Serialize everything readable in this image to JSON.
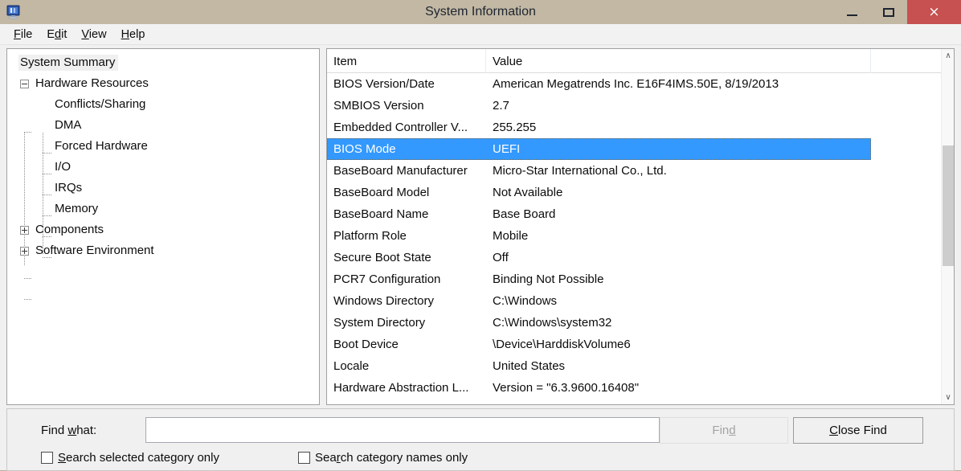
{
  "window": {
    "title": "System Information",
    "icon": "system-information-icon",
    "titlebar_color": "#c2b8a3",
    "close_button_color": "#c75050",
    "caption": {
      "minimize": "minimize-icon",
      "maximize": "maximize-icon",
      "close": "×"
    }
  },
  "menubar": [
    {
      "label": "File",
      "accel_before": "",
      "accel": "F",
      "accel_after": "ile"
    },
    {
      "label": "Edit",
      "accel_before": "E",
      "accel": "d",
      "accel_after": "it"
    },
    {
      "label": "View",
      "accel_before": "",
      "accel": "V",
      "accel_after": "iew"
    },
    {
      "label": "Help",
      "accel_before": "",
      "accel": "H",
      "accel_after": "elp"
    }
  ],
  "tree": {
    "selected": "System Summary",
    "selection_color": "#f0f0f0",
    "nodes": [
      {
        "label": "System Summary",
        "level": 0,
        "expander": "none",
        "selected": true
      },
      {
        "label": "Hardware Resources",
        "level": 0,
        "expander": "minus",
        "selected": false
      },
      {
        "label": "Conflicts/Sharing",
        "level": 1,
        "expander": "none",
        "selected": false
      },
      {
        "label": "DMA",
        "level": 1,
        "expander": "none",
        "selected": false
      },
      {
        "label": "Forced Hardware",
        "level": 1,
        "expander": "none",
        "selected": false
      },
      {
        "label": "I/O",
        "level": 1,
        "expander": "none",
        "selected": false
      },
      {
        "label": "IRQs",
        "level": 1,
        "expander": "none",
        "selected": false
      },
      {
        "label": "Memory",
        "level": 1,
        "expander": "none",
        "selected": false
      },
      {
        "label": "Components",
        "level": 0,
        "expander": "plus",
        "selected": false
      },
      {
        "label": "Software Environment",
        "level": 0,
        "expander": "plus",
        "selected": false
      }
    ]
  },
  "list": {
    "columns": [
      "Item",
      "Value"
    ],
    "selection_color": "#3399ff",
    "selected_row_index": 3,
    "rows": [
      {
        "item": "BIOS Version/Date",
        "value": "American Megatrends Inc. E16F4IMS.50E, 8/19/2013"
      },
      {
        "item": "SMBIOS Version",
        "value": "2.7"
      },
      {
        "item": "Embedded Controller V...",
        "value": "255.255"
      },
      {
        "item": "BIOS Mode",
        "value": "UEFI"
      },
      {
        "item": "BaseBoard Manufacturer",
        "value": "Micro-Star International Co., Ltd."
      },
      {
        "item": "BaseBoard Model",
        "value": "Not Available"
      },
      {
        "item": "BaseBoard Name",
        "value": "Base Board"
      },
      {
        "item": "Platform Role",
        "value": "Mobile"
      },
      {
        "item": "Secure Boot State",
        "value": "Off"
      },
      {
        "item": "PCR7 Configuration",
        "value": "Binding Not Possible"
      },
      {
        "item": "Windows Directory",
        "value": "C:\\Windows"
      },
      {
        "item": "System Directory",
        "value": "C:\\Windows\\system32"
      },
      {
        "item": "Boot Device",
        "value": "\\Device\\HarddiskVolume6"
      },
      {
        "item": "Locale",
        "value": "United States"
      },
      {
        "item": "Hardware Abstraction L...",
        "value": "Version = \"6.3.9600.16408\""
      }
    ],
    "scrollbar": {
      "up_arrow": "∧",
      "down_arrow": "∨"
    }
  },
  "findbar": {
    "label_before": "Find ",
    "label_accel": "w",
    "label_after": "hat:",
    "input_value": "",
    "input_placeholder": "",
    "find_button": {
      "before": "Fin",
      "accel": "d",
      "after": ""
    },
    "close_find_button": {
      "before": "",
      "accel": "C",
      "after": "lose Find"
    },
    "checkboxes": [
      {
        "before": "",
        "accel": "S",
        "after": "earch selected category only",
        "checked": false
      },
      {
        "before": "Sea",
        "accel": "r",
        "after": "ch category names only",
        "checked": false
      }
    ]
  }
}
